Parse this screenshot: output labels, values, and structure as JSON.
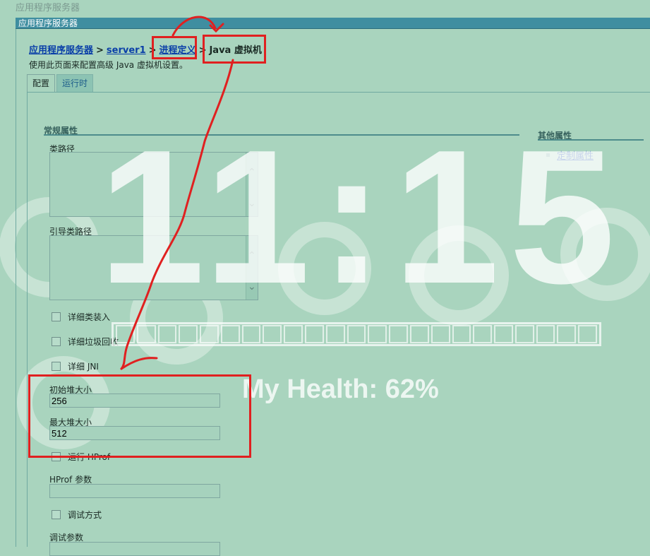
{
  "top_crumb": "应用程序服务器",
  "titlebar": "应用程序服务器",
  "breadcrumb": {
    "item1": "应用程序服务器",
    "item2": "server1",
    "item3": "进程定义",
    "current": "Java 虚拟机",
    "sep": ">"
  },
  "description": "使用此页面来配置高级 Java 虚拟机设置。",
  "tabs": [
    {
      "label": "配置"
    },
    {
      "label": "运行时"
    }
  ],
  "general": {
    "title": "常规属性",
    "classpath_label": "类路径",
    "bootclasspath_label": "引导类路径",
    "verbose_class_label": "详细类装入",
    "verbose_gc_label": "详细垃圾回收",
    "verbose_jni_label": "详细 JNI",
    "initial_heap_label": "初始堆大小",
    "initial_heap_value": "256",
    "max_heap_label": "最大堆大小",
    "max_heap_value": "512",
    "run_hprof_label": "运行 HProf",
    "hprof_params_label": "HProf 参数",
    "debug_mode_label": "调试方式",
    "debug_params_label": "调试参数"
  },
  "additional": {
    "title": "其他属性",
    "custom_props_link": "定制属性"
  },
  "watermark": {
    "clock": "11:15",
    "health": "My Health: 62%",
    "health_level": 0.62
  },
  "colors": {
    "annotation_red": "#e02020",
    "link_blue": "#0a3fa8",
    "titlebar": "#3f8ea0"
  }
}
